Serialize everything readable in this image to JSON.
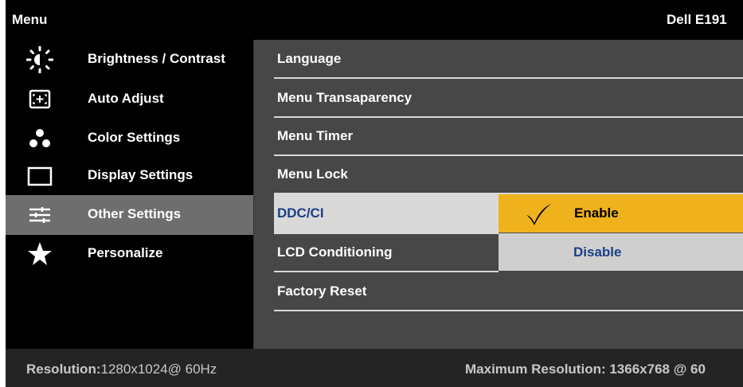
{
  "header": {
    "title": "Menu",
    "model": "Dell E191"
  },
  "sidebar": {
    "items": [
      {
        "label": "Brightness / Contrast",
        "icon": "brightness-icon"
      },
      {
        "label": "Auto Adjust",
        "icon": "auto-adjust-icon"
      },
      {
        "label": "Color Settings",
        "icon": "color-settings-icon"
      },
      {
        "label": "Display Settings",
        "icon": "display-settings-icon"
      },
      {
        "label": "Other Settings",
        "icon": "other-settings-icon",
        "selected": true
      },
      {
        "label": "Personalize",
        "icon": "star-icon"
      }
    ]
  },
  "content": {
    "rows": [
      {
        "label": "Language"
      },
      {
        "label": "Menu Transaparency"
      },
      {
        "label": "Menu Timer"
      },
      {
        "label": "Menu Lock"
      },
      {
        "label": "DDC/CI",
        "highlighted": true
      },
      {
        "label": "LCD Conditioning"
      },
      {
        "label": "Factory Reset"
      }
    ],
    "options": {
      "enable": "Enable",
      "disable": "Disable",
      "selected": "Enable"
    }
  },
  "footer": {
    "resolution_label": "Resolution:",
    "resolution_value": "1280x1024@ 60Hz",
    "max_resolution": "Maximum Resolution: 1366x768 @ 60"
  },
  "colors": {
    "background": "#000000",
    "content_panel": "#474747",
    "selected_item": "#6e6e6e",
    "highlight_row": "#d9d9d9",
    "enable_option": "#f0b21c",
    "disable_option": "#cfcfcf",
    "highlight_text": "#1a3f86",
    "footer": "#242424"
  }
}
